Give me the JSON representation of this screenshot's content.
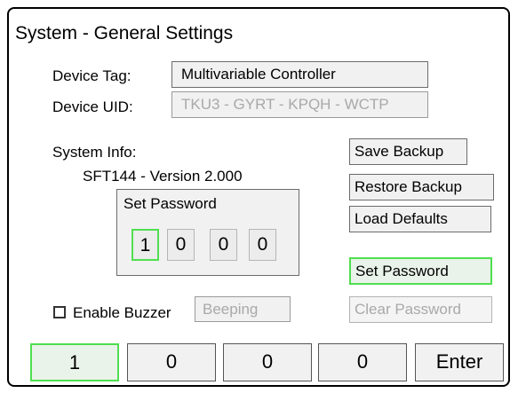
{
  "title": "System - General Settings",
  "device_tag": {
    "label": "Device Tag:",
    "value": "Multivariable Controller"
  },
  "device_uid": {
    "label": "Device UID:",
    "value": "TKU3 - GYRT - KPQH - WCTP"
  },
  "system_info": {
    "label": "System Info:",
    "version": "SFT144 - Version 2.000"
  },
  "password_panel": {
    "title": "Set Password",
    "digits": [
      "1",
      "0",
      "0",
      "0"
    ],
    "selected_index": 0
  },
  "buttons": {
    "save_backup": "Save Backup",
    "restore_backup": "Restore Backup",
    "load_defaults": "Load Defaults",
    "set_password": "Set Password",
    "clear_password": "Clear Password"
  },
  "buzzer": {
    "label": "Enable Buzzer",
    "checked": false,
    "status": "Beeping"
  },
  "keypad": {
    "keys": [
      "1",
      "0",
      "0",
      "0",
      "Enter"
    ],
    "selected_index": 0
  },
  "colors": {
    "highlight": "#4fdf4f",
    "field_bg": "#f1f1f1",
    "disabled_text": "#a9a9a9"
  }
}
